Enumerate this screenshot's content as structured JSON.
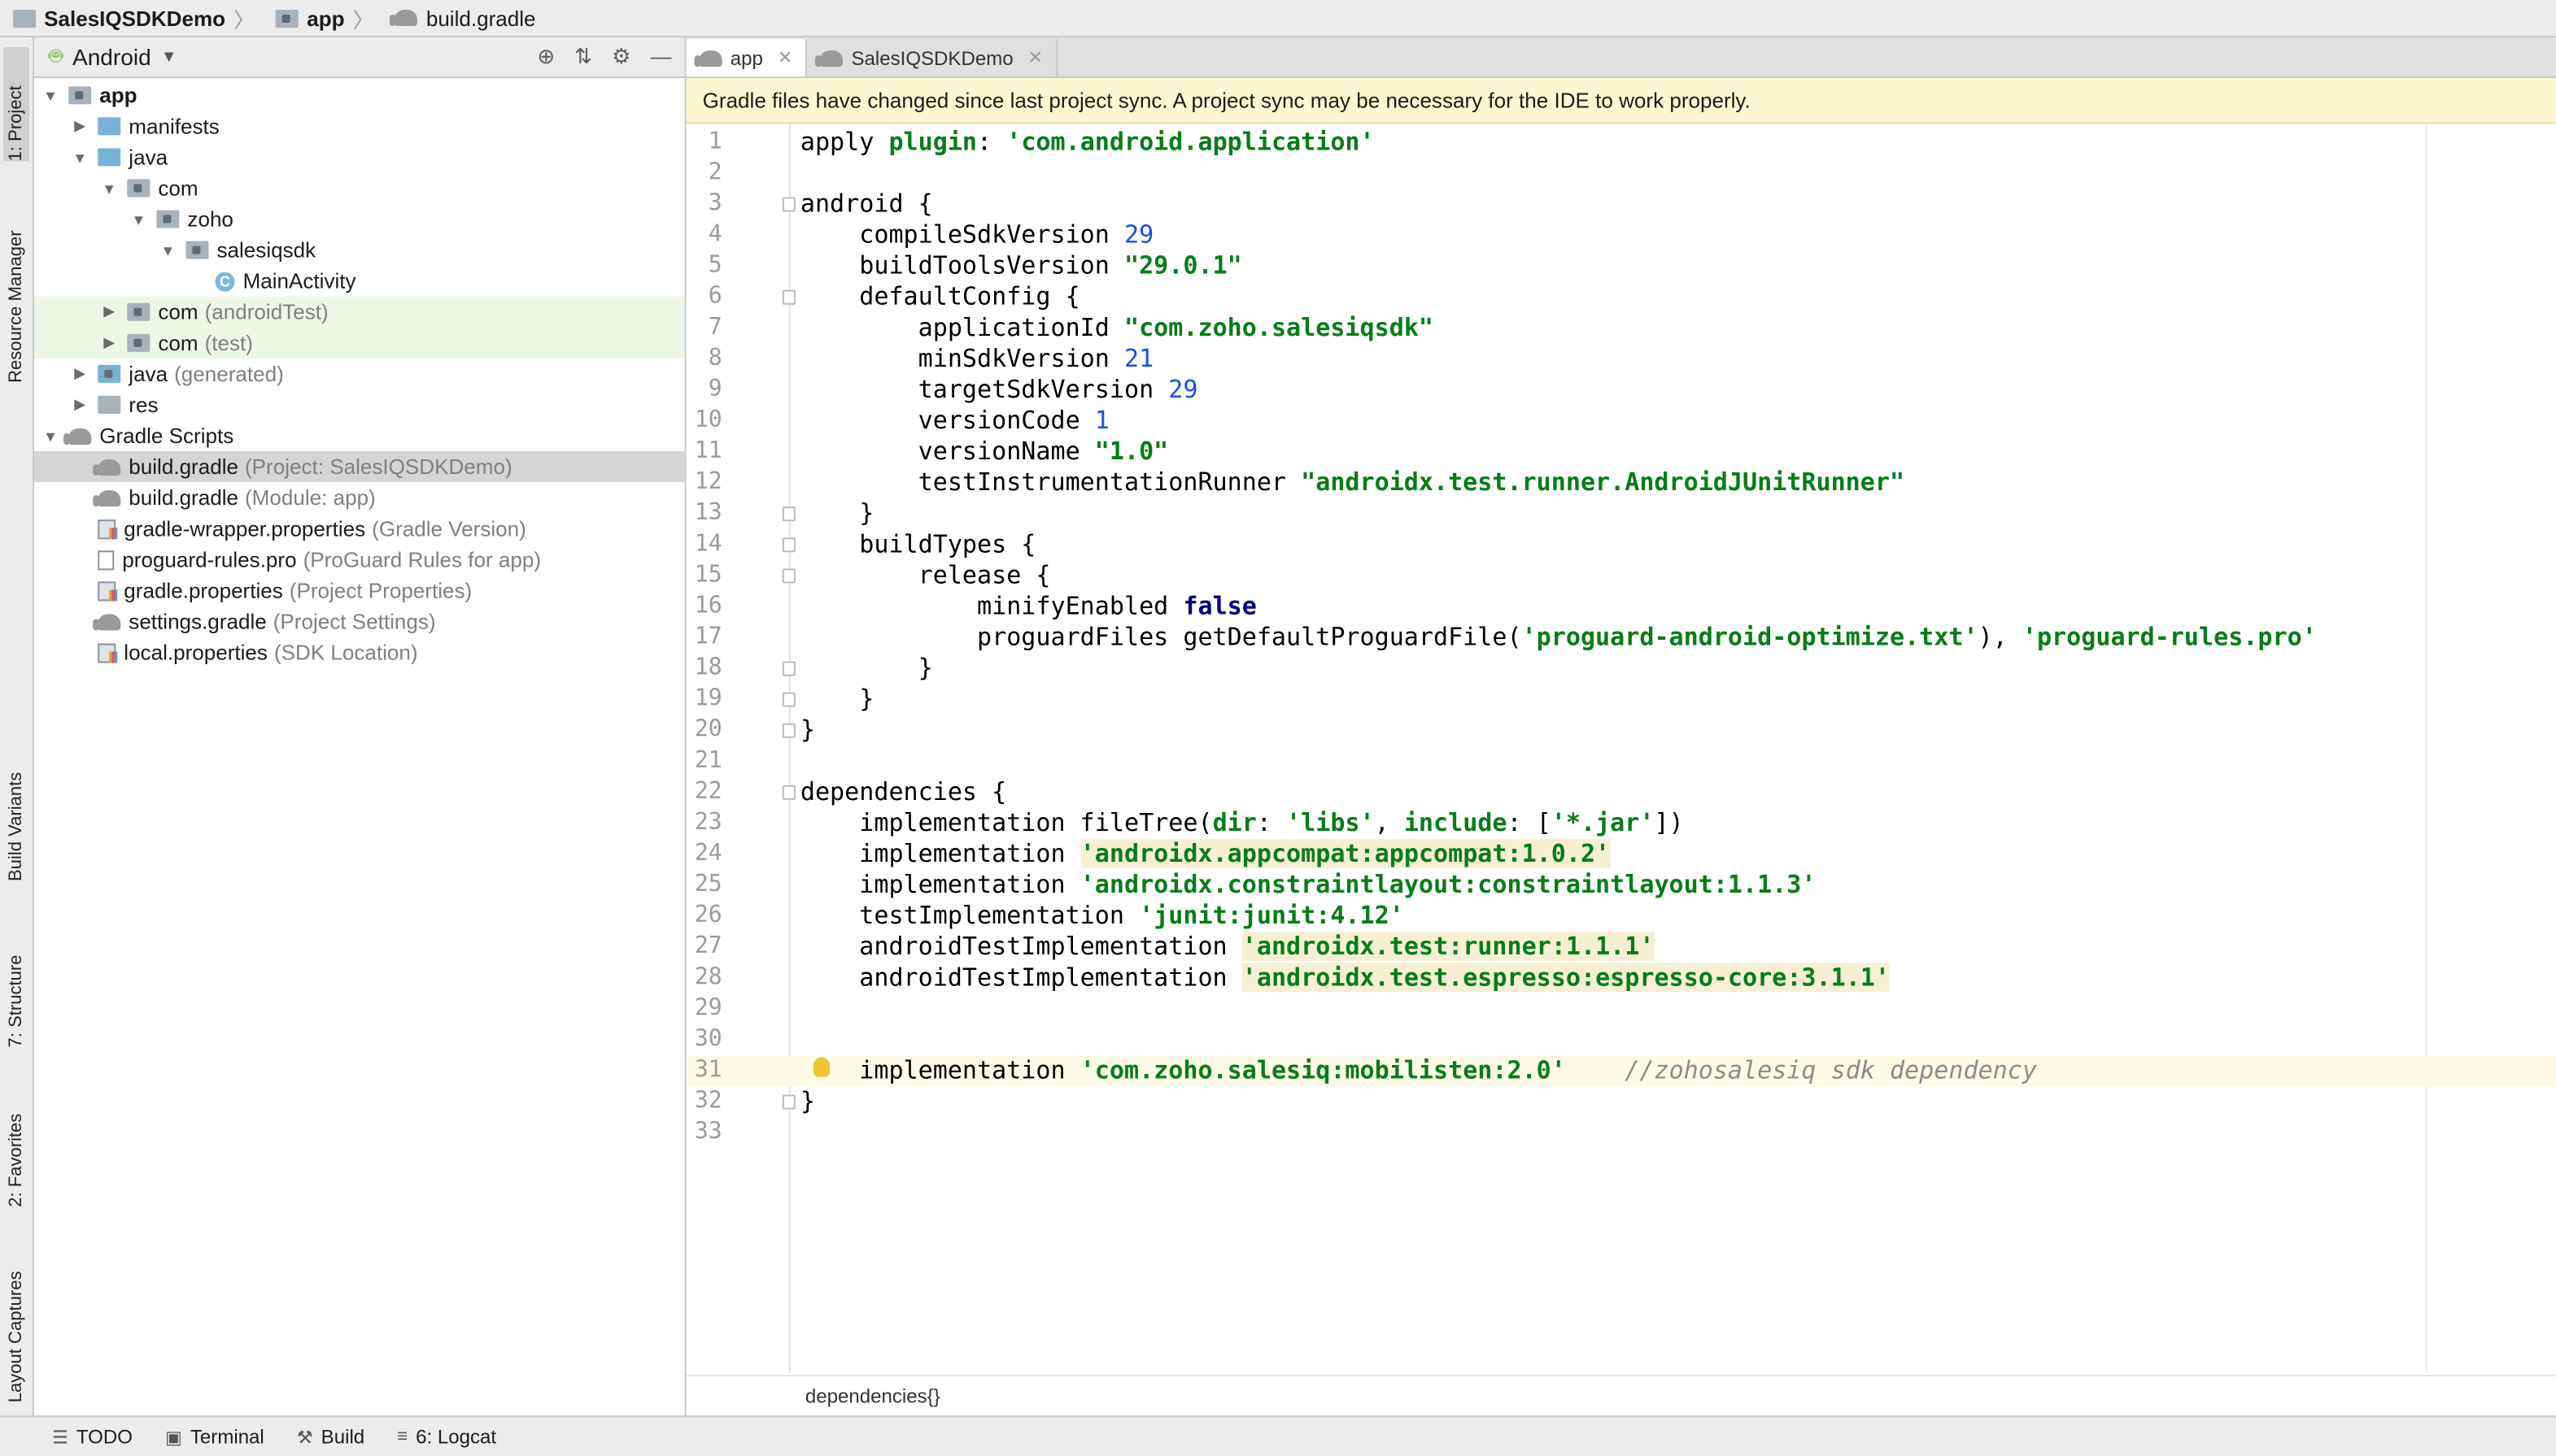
{
  "breadcrumb": [
    {
      "label": "SalesIQSDKDemo",
      "icon": "folder-icon"
    },
    {
      "label": "app",
      "icon": "module-folder-icon"
    },
    {
      "label": "build.gradle",
      "icon": "gradle-icon"
    }
  ],
  "left_strip": {
    "project": "1: Project",
    "resource_manager": "Resource Manager",
    "build_variants": "Build Variants",
    "structure": "7: Structure",
    "favorites": "2: Favorites",
    "layout_captures": "Layout Captures"
  },
  "project_panel": {
    "view_selector": "Android",
    "tree": [
      {
        "label": "app",
        "extra": "",
        "depth": 0,
        "expanded": true
      },
      {
        "label": "manifests",
        "extra": "",
        "depth": 1,
        "expanded": false
      },
      {
        "label": "java",
        "extra": "",
        "depth": 1,
        "expanded": true
      },
      {
        "label": "com",
        "extra": "",
        "depth": 2,
        "expanded": true
      },
      {
        "label": "zoho",
        "extra": "",
        "depth": 3,
        "expanded": true
      },
      {
        "label": "salesiqsdk",
        "extra": "",
        "depth": 4,
        "expanded": true
      },
      {
        "label": "MainActivity",
        "extra": "",
        "depth": 5
      },
      {
        "label": "com",
        "extra": "(androidTest)",
        "depth": 2,
        "expanded": false
      },
      {
        "label": "com",
        "extra": "(test)",
        "depth": 2,
        "expanded": false
      },
      {
        "label": "java",
        "extra": "(generated)",
        "depth": 1,
        "expanded": false
      },
      {
        "label": "res",
        "extra": "",
        "depth": 1,
        "expanded": false
      },
      {
        "label": "Gradle Scripts",
        "extra": "",
        "depth": 0,
        "expanded": true
      },
      {
        "label": "build.gradle",
        "extra": "(Project: SalesIQSDKDemo)",
        "depth": 1
      },
      {
        "label": "build.gradle",
        "extra": "(Module: app)",
        "depth": 1
      },
      {
        "label": "gradle-wrapper.properties",
        "extra": "(Gradle Version)",
        "depth": 1
      },
      {
        "label": "proguard-rules.pro",
        "extra": "(ProGuard Rules for app)",
        "depth": 1
      },
      {
        "label": "gradle.properties",
        "extra": "(Project Properties)",
        "depth": 1
      },
      {
        "label": "settings.gradle",
        "extra": "(Project Settings)",
        "depth": 1
      },
      {
        "label": "local.properties",
        "extra": "(SDK Location)",
        "depth": 1
      }
    ]
  },
  "editor": {
    "tabs": [
      {
        "label": "app",
        "close": "✕"
      },
      {
        "label": "SalesIQSDKDemo",
        "close": "✕"
      }
    ],
    "banner": "Gradle files have changed since last project sync. A project sync may be necessary for the IDE to work properly.",
    "lines": [
      "apply plugin: 'com.android.application'",
      "",
      "android {",
      "    compileSdkVersion 29",
      "    buildToolsVersion \"29.0.1\"",
      "    defaultConfig {",
      "        applicationId \"com.zoho.salesiqsdk\"",
      "        minSdkVersion 21",
      "        targetSdkVersion 29",
      "        versionCode 1",
      "        versionName \"1.0\"",
      "        testInstrumentationRunner \"androidx.test.runner.AndroidJUnitRunner\"",
      "    }",
      "    buildTypes {",
      "        release {",
      "            minifyEnabled false",
      "            proguardFiles getDefaultProguardFile('proguard-android-optimize.txt'), 'proguard-rules.pro'",
      "        }",
      "    }",
      "}",
      "",
      "dependencies {",
      "    implementation fileTree(dir: 'libs', include: ['*.jar'])",
      "    implementation 'androidx.appcompat:appcompat:1.0.2'",
      "    implementation 'androidx.constraintlayout:constraintlayout:1.1.3'",
      "    testImplementation 'junit:junit:4.12'",
      "    androidTestImplementation 'androidx.test:runner:1.1.1'",
      "    androidTestImplementation 'androidx.test.espresso:espresso-core:3.1.1'",
      "",
      "",
      "    implementation 'com.zoho.salesiq:mobilisten:2.0'    //zohosalesiq sdk dependency",
      "}",
      ""
    ],
    "current_line": 31,
    "status_breadcrumb": "dependencies{}"
  },
  "bottom_bar": [
    {
      "label": "TODO",
      "icon": "list-icon"
    },
    {
      "label": "Terminal",
      "icon": "terminal-icon"
    },
    {
      "label": "Build",
      "icon": "hammer-icon"
    },
    {
      "label": "6: Logcat",
      "icon": "logcat-icon"
    }
  ]
}
